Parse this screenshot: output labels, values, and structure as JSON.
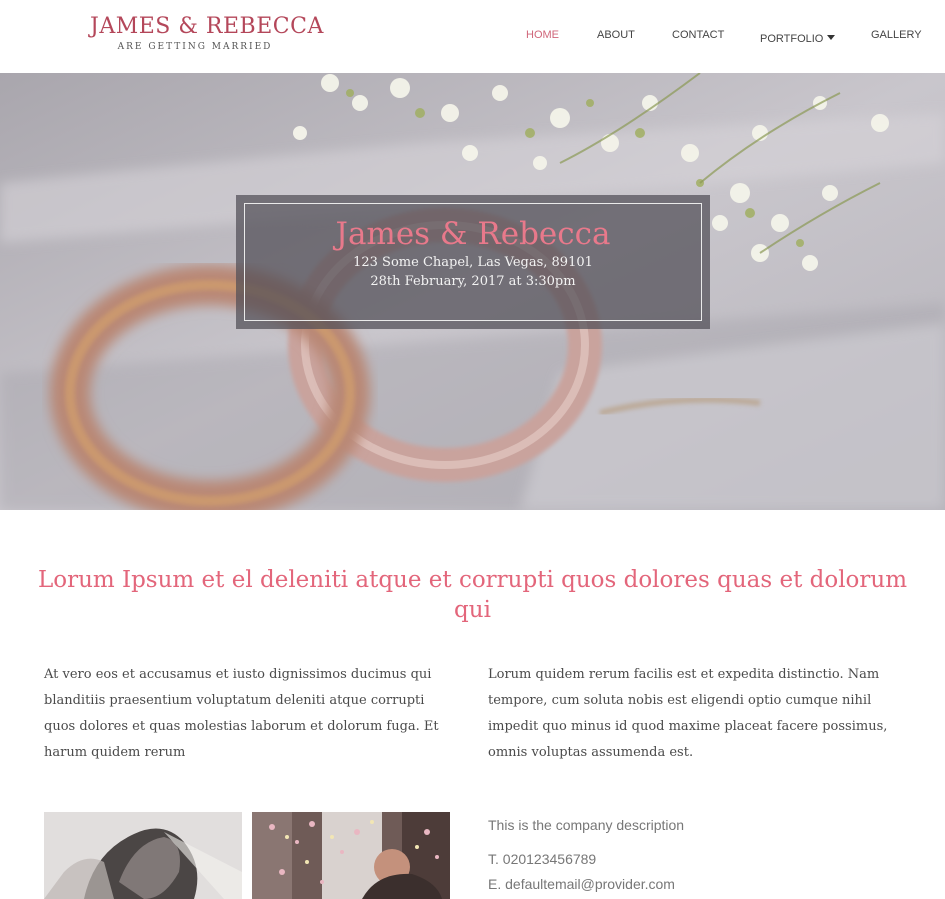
{
  "header": {
    "brand_title": "JAMES & REBECCA",
    "brand_subtitle": "ARE GETTING MARRIED",
    "nav": [
      {
        "label": "HOME",
        "active": true
      },
      {
        "label": "ABOUT",
        "active": false
      },
      {
        "label": "CONTACT",
        "active": false
      },
      {
        "label": "PORTFOLIO",
        "active": false,
        "dropdown": true
      },
      {
        "label": "GALLERY",
        "active": false
      }
    ]
  },
  "hero": {
    "name": "James & Rebecca",
    "address": "123 Some Chapel, Las Vegas, 89101",
    "date": "28th February, 2017 at 3:30pm"
  },
  "main": {
    "headline": "Lorum Ipsum et el deleniti atque et corrupti quos dolores quas et dolorum qui",
    "left_text": "At vero eos et accusamus et iusto dignissimos ducimus qui blanditiis praesentium voluptatum deleniti atque corrupti quos dolores et quas molestias laborum et dolorum fuga. Et harum quidem rerum",
    "right_text": "Lorum quidem rerum facilis est et expedita distinctio. Nam tempore, cum soluta nobis est eligendi optio cumque nihil impedit quo minus id quod maxime placeat facere possimus, omnis voluptas assumenda est."
  },
  "footer_info": {
    "description": "This is the company description",
    "phone": "T. 020123456789",
    "email": "E. defaultemail@provider.com"
  },
  "colors": {
    "accent": "#e3667b",
    "brand": "#b4475a"
  }
}
